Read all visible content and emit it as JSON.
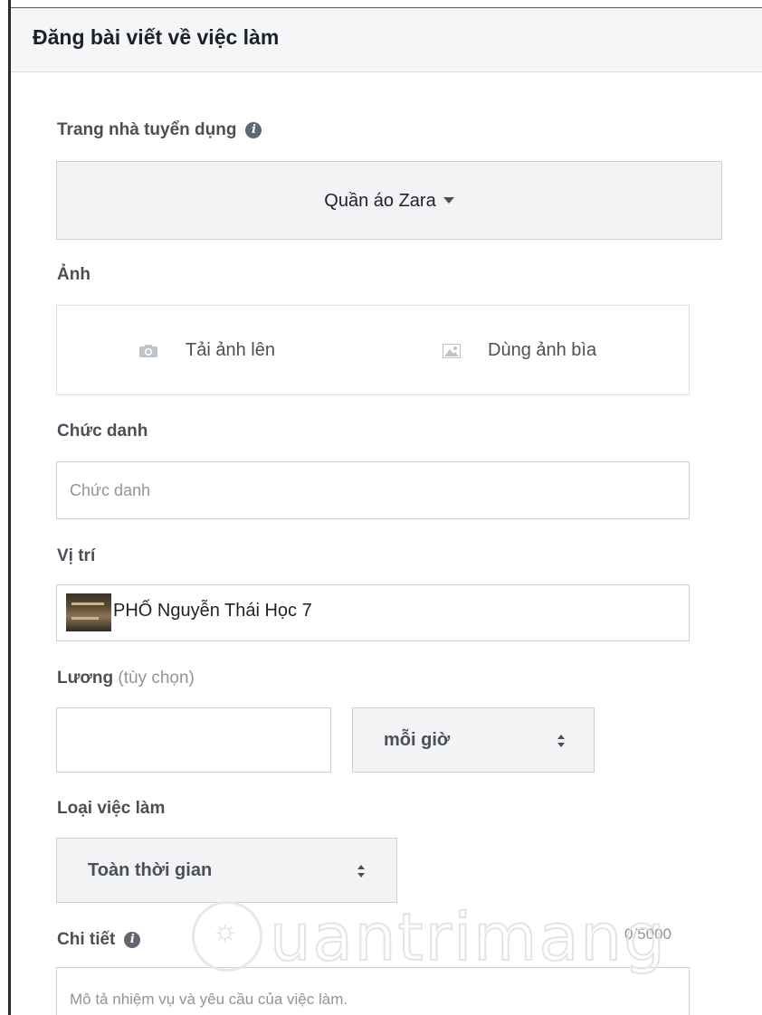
{
  "header": {
    "title": "Đăng bài viết về việc làm"
  },
  "employer": {
    "label": "Trang nhà tuyển dụng",
    "value": "Quần áo Zara"
  },
  "photo": {
    "label": "Ảnh",
    "upload": "Tải ảnh lên",
    "use_cover": "Dùng ảnh bìa"
  },
  "job_title": {
    "label": "Chức danh",
    "placeholder": "Chức danh",
    "value": ""
  },
  "location": {
    "label": "Vị trí",
    "value": "PHỐ Nguyễn Thái Học 7"
  },
  "salary": {
    "label": "Lương",
    "optional": "(tùy chọn)",
    "value": "",
    "period": "mỗi giờ"
  },
  "job_type": {
    "label": "Loại việc làm",
    "value": "Toàn thời gian"
  },
  "details": {
    "label": "Chi tiết",
    "counter": "0/5000",
    "placeholder": "Mô tả nhiệm vụ và yêu cầu của việc làm."
  },
  "watermark": {
    "text": "uantrimang"
  },
  "icons": {
    "info": "info-icon",
    "caret": "caret-down-icon",
    "camera": "camera-icon",
    "image": "image-icon",
    "select": "select-arrows-icon"
  },
  "colors": {
    "header_bg": "#f5f6f7",
    "field_bg": "#f2f3f5",
    "border": "#ccd0d5",
    "label": "#4b4f56",
    "placeholder": "#90949c"
  }
}
